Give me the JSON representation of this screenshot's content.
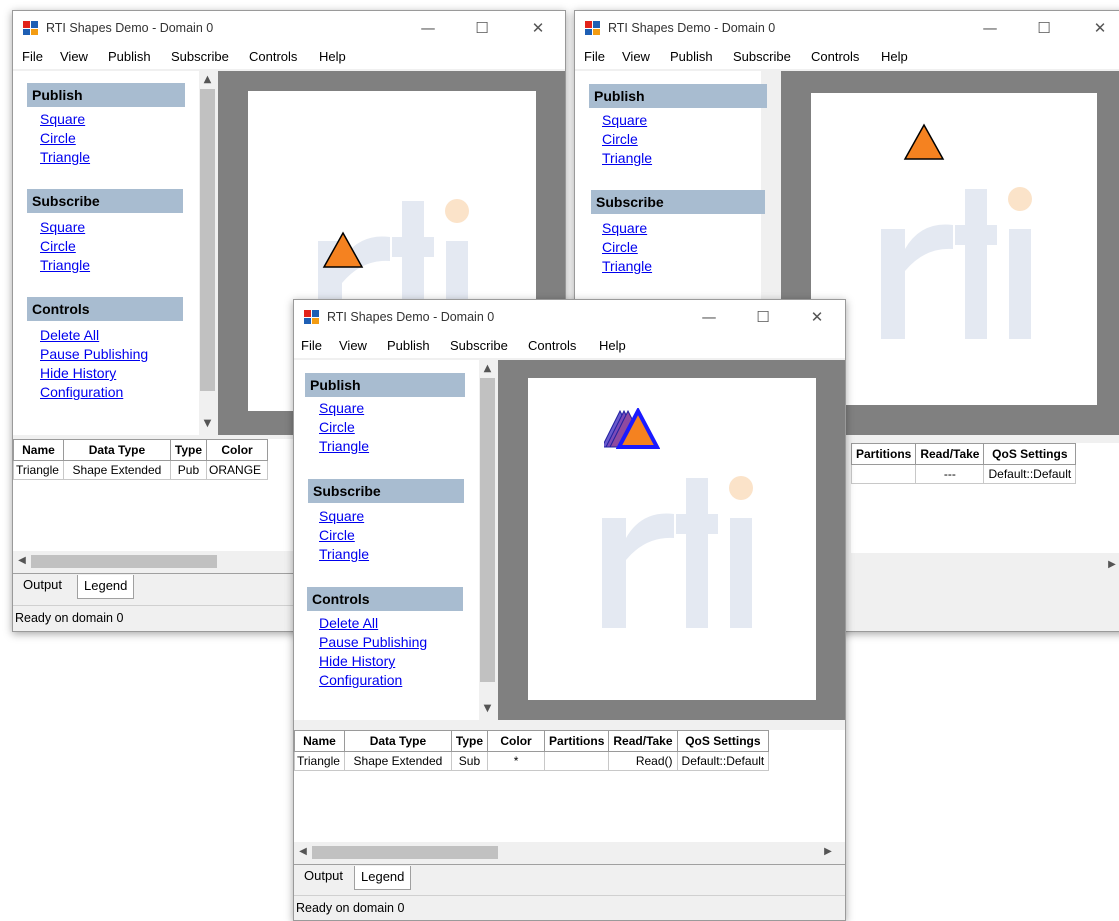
{
  "app": {
    "title": "RTI Shapes Demo - Domain 0"
  },
  "window_controls": {
    "minimize": "—",
    "maximize": "☐",
    "close": "✕"
  },
  "menu": [
    "File",
    "View",
    "Publish",
    "Subscribe",
    "Controls",
    "Help"
  ],
  "sidebar": {
    "publish_title": "Publish",
    "subscribe_title": "Subscribe",
    "controls_title": "Controls",
    "shapes": [
      "Square",
      "Circle",
      "Triangle"
    ],
    "controls": [
      "Delete All",
      "Pause Publishing",
      "Hide History",
      "Configuration"
    ]
  },
  "table": {
    "headers": [
      "Name",
      "Data Type",
      "Type",
      "Color",
      "Partitions",
      "Read/Take",
      "QoS Settings"
    ],
    "pub_row": [
      "Triangle",
      "Shape Extended",
      "Pub",
      "ORANGE"
    ],
    "right_row": [
      "---",
      "Default::Default"
    ],
    "sub_row": [
      "Triangle",
      "Shape Extended",
      "Sub",
      "*",
      "",
      "Read()",
      "Default::Default"
    ]
  },
  "tabs": {
    "output": "Output",
    "legend": "Legend"
  },
  "status": "Ready on domain 0",
  "colors": {
    "orange": "#f58220",
    "blue": "#1a1aff",
    "section_bg": "#a8bcd0",
    "link": "#0000ee"
  }
}
